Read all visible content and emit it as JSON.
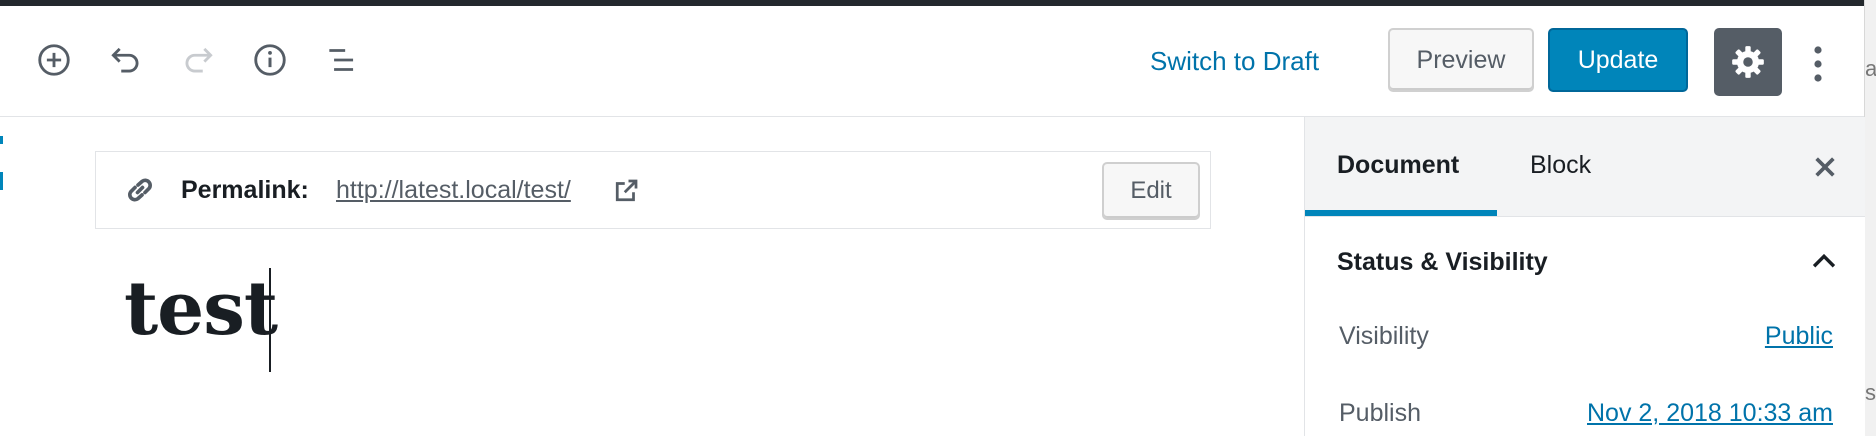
{
  "header": {
    "switch_to_draft": "Switch to Draft",
    "preview": "Preview",
    "update": "Update"
  },
  "icons": {
    "add_block": "plus-circle-icon",
    "undo": "undo-icon",
    "redo": "redo-icon",
    "info": "info-icon",
    "outline": "list-outline-icon",
    "settings": "gear-icon",
    "more": "vertical-ellipsis-icon",
    "permalink": "link-icon",
    "external": "external-link-icon",
    "close": "close-icon",
    "collapse": "chevron-up-icon"
  },
  "permalink": {
    "label": "Permalink:",
    "url": "http://latest.local/test/",
    "edit": "Edit"
  },
  "post": {
    "title": "test"
  },
  "sidebar": {
    "tabs": [
      {
        "label": "Document",
        "active": true
      },
      {
        "label": "Block",
        "active": false
      }
    ],
    "panel": {
      "title": "Status & Visibility",
      "rows": [
        {
          "label": "Visibility",
          "value": "Public"
        },
        {
          "label": "Publish",
          "value": "Nov 2, 2018 10:33 am"
        }
      ]
    }
  },
  "right_edge": {
    "fragment_1": "a",
    "fragment_2": "s"
  },
  "colors": {
    "accent": "#0085ba",
    "link": "#0073aa",
    "dark": "#191e23",
    "muted": "#555d66",
    "settings_bg": "#555d66"
  }
}
